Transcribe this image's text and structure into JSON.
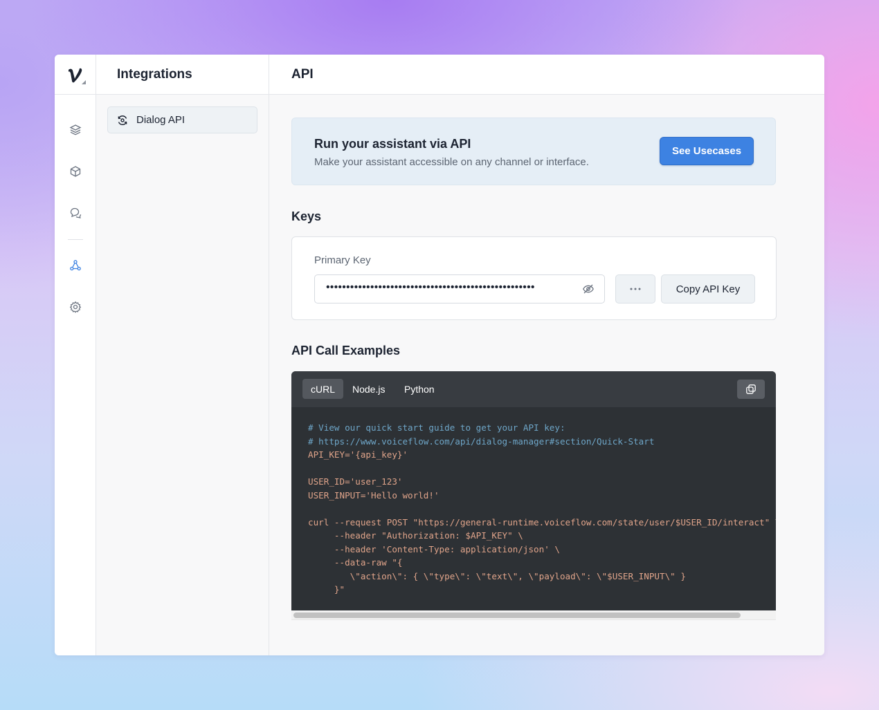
{
  "sidebar_panel": {
    "title": "Integrations",
    "items": [
      {
        "label": "Dialog API",
        "icon": "refresh-api-icon",
        "selected": true
      }
    ]
  },
  "rail": {
    "logo": "V",
    "icons": [
      "layers-icon",
      "cube-icon",
      "chat-icon",
      "integrations-icon",
      "settings-icon"
    ],
    "active_icon": "integrations-icon"
  },
  "main": {
    "title": "API",
    "promo": {
      "title": "Run your assistant via API",
      "subtitle": "Make your assistant accessible on any channel or interface.",
      "button_label": "See Usecases"
    },
    "keys": {
      "title": "Keys",
      "primary_label": "Primary Key",
      "masked_value": "••••••••••••••••••••••••••••••••••••••••••••••••••••",
      "more_icon": "ellipsis-icon",
      "copy_label": "Copy API Key"
    },
    "examples": {
      "title": "API Call Examples",
      "tabs": [
        {
          "label": "cURL",
          "active": true
        },
        {
          "label": "Node.js",
          "active": false
        },
        {
          "label": "Python",
          "active": false
        }
      ],
      "lines": [
        {
          "text": "# View our quick start guide to get your API key:",
          "kind": "comment"
        },
        {
          "text": "# https://www.voiceflow.com/api/dialog-manager#section/Quick-Start",
          "kind": "comment"
        },
        {
          "text": "API_KEY='{api_key}'",
          "kind": "code"
        },
        {
          "text": "",
          "kind": "code"
        },
        {
          "text": "USER_ID='user_123'",
          "kind": "code"
        },
        {
          "text": "USER_INPUT='Hello world!'",
          "kind": "code"
        },
        {
          "text": "",
          "kind": "code"
        },
        {
          "text": "curl --request POST \"https://general-runtime.voiceflow.com/state/user/$USER_ID/interact\" \\",
          "kind": "code"
        },
        {
          "text": "     --header \"Authorization: $API_KEY\" \\",
          "kind": "code"
        },
        {
          "text": "     --header 'Content-Type: application/json' \\",
          "kind": "code"
        },
        {
          "text": "     --data-raw \"{",
          "kind": "code"
        },
        {
          "text": "        \\\"action\\\": { \\\"type\\\": \\\"text\\\", \\\"payload\\\": \\\"$USER_INPUT\\\" }",
          "kind": "code"
        },
        {
          "text": "     }\"",
          "kind": "code"
        }
      ]
    }
  },
  "colors": {
    "accent": "#3d82e2",
    "code_bg": "#2d3135",
    "code_text": "#e0a48a",
    "code_comment": "#6ea6c8",
    "active_rail_icon": "#3d82e2"
  }
}
